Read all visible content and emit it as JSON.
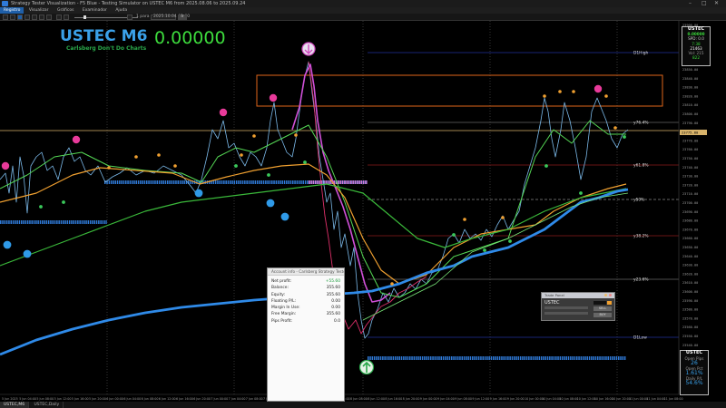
{
  "window": {
    "title": "Strategy Tester Visualization - F5 Blue - Testing Simulator on USTEC M6 from 2025.08.06 to 2025.09.24",
    "min_glyph": "–",
    "max_glyph": "□",
    "close_glyph": "✕"
  },
  "menu": {
    "items": [
      {
        "label": "Registro",
        "active": true
      },
      {
        "label": "Visualizar",
        "active": false
      },
      {
        "label": "Gráficos",
        "active": false
      },
      {
        "label": "Examinador",
        "active": false
      },
      {
        "label": "Ajuda",
        "active": false
      }
    ]
  },
  "toolbar": {
    "speed_label": "1 para",
    "date_value": "2025.10.04 00:00",
    "go_label": "Ir"
  },
  "overlay": {
    "symbol_title": "USTEC M6",
    "subtitle": "Carlsberg Don't Do Charts",
    "big_value": "0.00000",
    "title_color": "#3aa0e8",
    "subtitle_color": "#2aa84a",
    "value_color": "#3ddc3d"
  },
  "levels": {
    "d1_high": "D1High",
    "y76": "y76.4%",
    "y61": "y61.8%",
    "y50": "y50%",
    "y38": "y38.2%",
    "y23": "y23.6%",
    "d1_low": "D1Low"
  },
  "price_axis": [
    "23900.00",
    "23890.00",
    "23880.00",
    "23870.00",
    "23860.00",
    "23850.00",
    "23840.00",
    "23830.00",
    "23820.00",
    "23810.00",
    "23800.00",
    "23790.00",
    "23780.00",
    "23770.00",
    "23760.00",
    "23750.00",
    "23740.00",
    "23730.00",
    "23720.00",
    "23710.00",
    "23700.00",
    "23690.00",
    "23680.00",
    "23670.00",
    "23660.00",
    "23650.00",
    "23640.00",
    "23630.00",
    "23620.00",
    "23610.00",
    "23600.00",
    "23590.00",
    "23580.00",
    "23570.00",
    "23560.00",
    "23550.00",
    "23540.00",
    "23530.00",
    "23520.00",
    "23510.00",
    "23500.00",
    "23490.00"
  ],
  "current_price": "23775.80",
  "time_axis": [
    "5 Jun 2025",
    "5 Jun 04:00",
    "5 Jun 08:00",
    "5 Jun 12:00",
    "5 Jun 16:00",
    "5 Jun 20:00",
    "6 Jun 00:00",
    "6 Jun 04:00",
    "6 Jun 08:00",
    "6 Jun 12:00",
    "6 Jun 16:00",
    "6 Jun 20:00",
    "7 Jun 00:00",
    "7 Jun 04:00",
    "7 Jun 08:00",
    "7 Jun 12:00",
    "7 Jun 16:00",
    "7 Jun 20:00",
    "8 Jun 00:00",
    "8 Jun 04:00",
    "8 Jun 08:00",
    "8 Jun 12:00",
    "8 Jun 16:00",
    "8 Jun 20:00",
    "9 Jun 00:00",
    "9 Jun 04:00",
    "9 Jun 08:00",
    "9 Jun 12:00",
    "9 Jun 16:00",
    "9 Jun 20:00",
    "10 Jun 00:00",
    "10 Jun 04:00",
    "10 Jun 08:00",
    "10 Jun 12:00",
    "10 Jun 16:00",
    "10 Jun 20:00",
    "11 Jun 00:00",
    "11 Jun 04:00",
    "11 Jun 08:00"
  ],
  "account": {
    "header": "Account info - Carlsberg Strategy Tester",
    "rows": [
      {
        "label": "Net profit:",
        "value": "+55.60",
        "color": "#1a9a3a"
      },
      {
        "label": "Balance:",
        "value": "355.60",
        "color": "#222"
      },
      {
        "label": "Equity:",
        "value": "355.60",
        "color": "#222"
      },
      {
        "label": "Floating P/L:",
        "value": "0.00",
        "color": "#222"
      },
      {
        "label": "Margin In Use:",
        "value": "0.00",
        "color": "#222"
      },
      {
        "label": "Free Margin:",
        "value": "355.60",
        "color": "#222"
      },
      {
        "label": "Pips Profit:",
        "value": "0.0",
        "color": "#222"
      }
    ]
  },
  "mini_panel": {
    "header": "Trade Panel",
    "symbol": "USTEC",
    "button_a": "SELL",
    "button_b": "BUY"
  },
  "right_panel_top": {
    "symbol": "USTEC",
    "value": "0.00000",
    "line1": "SPD: 0.0",
    "line2": "7:38",
    "line3": "21463",
    "line4": "Vol: 215",
    "line5": "822"
  },
  "right_panel_bottom": {
    "symbol": "USTEC",
    "l1": "Open Pips",
    "v1": "26",
    "l2": "Open Pct",
    "v2": "1.61%",
    "l3": "Daily P/L",
    "v3": "54.6%"
  },
  "tabs": [
    {
      "label": "USTEC,M6",
      "active": true
    },
    {
      "label": "USTEC,Daily",
      "active": false
    }
  ]
}
